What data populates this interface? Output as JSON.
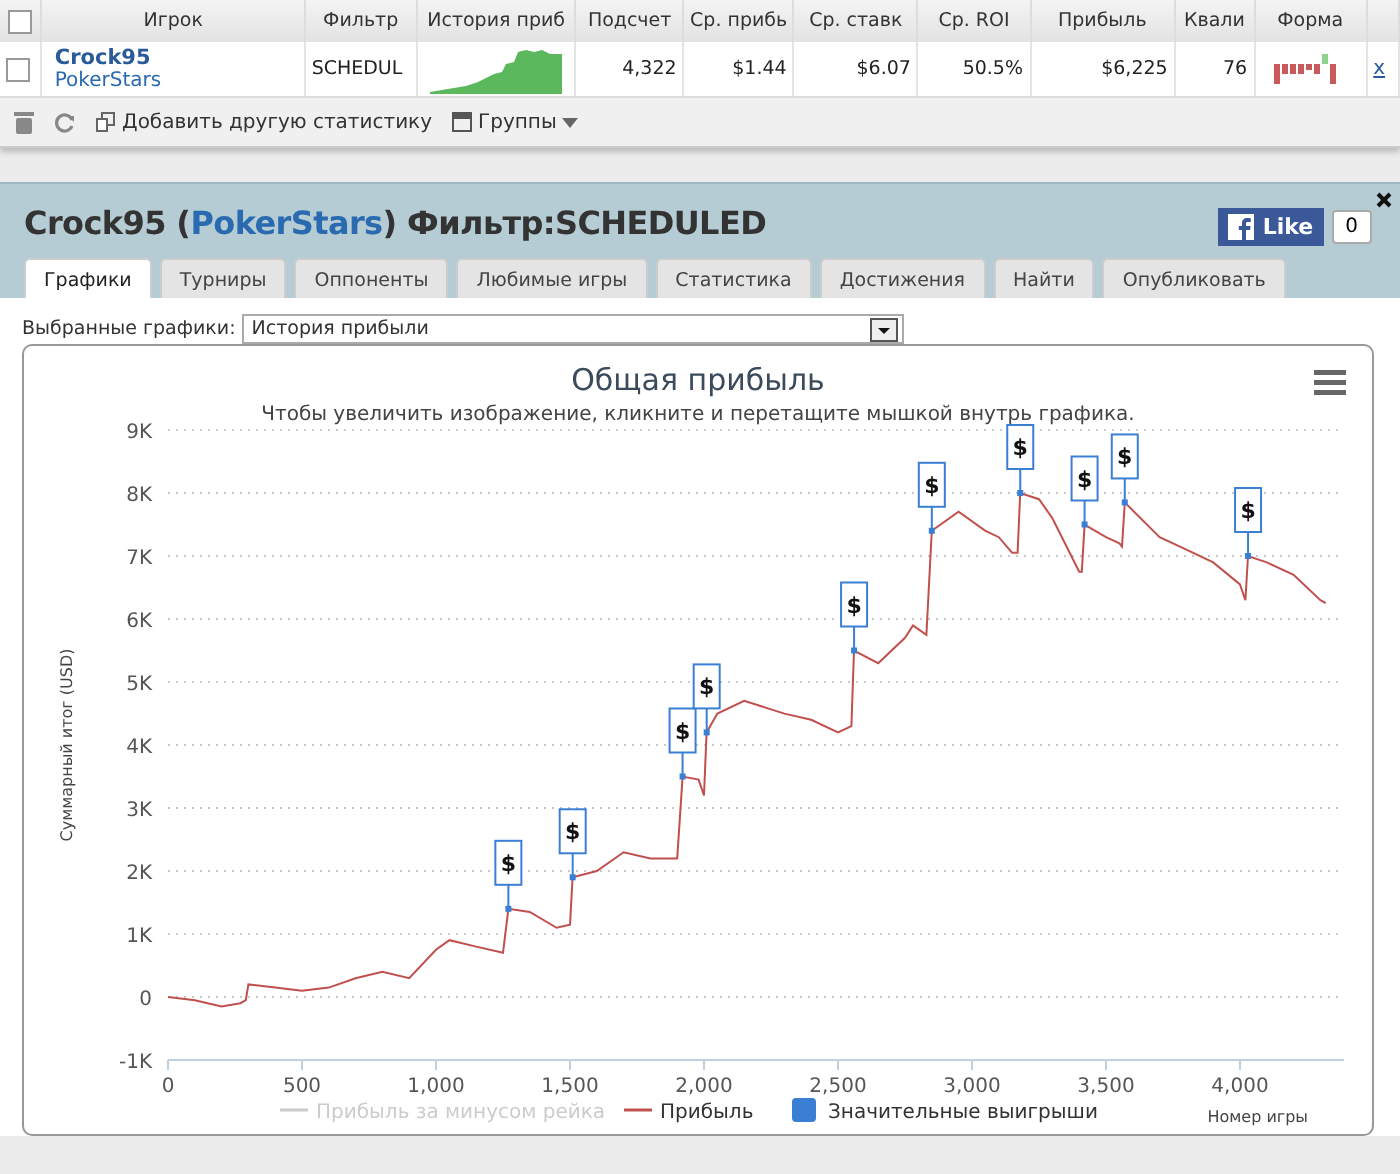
{
  "stats_table": {
    "all_checked": false,
    "columns": [
      "Игрок",
      "Фильтр",
      "История приб",
      "Подсчет",
      "Ср. прибь",
      "Ср. ставк",
      "Ср. ROI",
      "Прибыль",
      "Квали",
      "Форма"
    ],
    "rows": [
      {
        "checked": false,
        "player": "Crock95",
        "site": "PokerStars",
        "filter": "SCHEDUL",
        "count": "4,322",
        "avg_profit": "$1.44",
        "avg_stake": "$6.07",
        "avg_roi": "50.5%",
        "profit": "$6,225",
        "qualif": "76",
        "remove": "x"
      }
    ],
    "toolbar": {
      "add_stat": "Добавить другую статистику",
      "groups": "Группы"
    }
  },
  "profile": {
    "name": "Crock95",
    "open_paren": "(",
    "site": "PokerStars",
    "close_paren": ")",
    "filter": "Фильтр:SCHEDULED",
    "like": "Like",
    "like_count": "0",
    "tabs": [
      {
        "label": "Графики",
        "selected": true
      },
      {
        "label": "Турниры",
        "selected": false
      },
      {
        "label": "Оппоненты",
        "selected": false
      },
      {
        "label": "Любимые игры",
        "selected": false
      },
      {
        "label": "Статистика",
        "selected": false
      },
      {
        "label": "Достижения",
        "selected": false
      },
      {
        "label": "Найти",
        "selected": false
      },
      {
        "label": "Опубликовать",
        "selected": false
      }
    ],
    "chart_select": {
      "label": "Выбранные графики:",
      "value": "История прибыли"
    },
    "chart": {
      "subtitle": "Чтобы увеличить изображение, кликните и перетащите мышкой внутрь графика.",
      "hidden_legend": [
        {
          "label": "Прибыль за минусом рейка",
          "visible": false
        }
      ],
      "flag_labels": [
        "$",
        "$",
        "$",
        "$",
        "$",
        "$",
        "$",
        "$",
        "$",
        "$"
      ],
      "chart_data": {
        "type": "line",
        "title": "Общая прибыль",
        "xlabel": "Номер игры",
        "ylabel": "Суммарный итог (USD)",
        "xlim": [
          0,
          4388
        ],
        "ylim": [
          -1000,
          9000
        ],
        "grid": true,
        "legend": true,
        "xticks": [
          {
            "value": 0,
            "label": "0"
          },
          {
            "value": 500,
            "label": "500"
          },
          {
            "value": 1000,
            "label": "1,000"
          },
          {
            "value": 1500,
            "label": "1,500"
          },
          {
            "value": 2000,
            "label": "2,000"
          },
          {
            "value": 2500,
            "label": "2,500"
          },
          {
            "value": 3000,
            "label": "3,000"
          },
          {
            "value": 3500,
            "label": "3,500"
          },
          {
            "value": 4000,
            "label": "4,000"
          }
        ],
        "yticks": [
          {
            "value": -1000,
            "label": "-1K"
          },
          {
            "value": 0,
            "label": "0"
          },
          {
            "value": 1000,
            "label": "1K"
          },
          {
            "value": 2000,
            "label": "2K"
          },
          {
            "value": 3000,
            "label": "3K"
          },
          {
            "value": 4000,
            "label": "4K"
          },
          {
            "value": 5000,
            "label": "5K"
          },
          {
            "value": 6000,
            "label": "6K"
          },
          {
            "value": 7000,
            "label": "7K"
          },
          {
            "value": 8000,
            "label": "8K"
          },
          {
            "value": 9000,
            "label": "9K"
          }
        ],
        "x": [
          0,
          100,
          200,
          270,
          290,
          300,
          400,
          500,
          600,
          700,
          800,
          900,
          1000,
          1050,
          1150,
          1250,
          1270,
          1350,
          1450,
          1500,
          1510,
          1600,
          1700,
          1800,
          1900,
          1920,
          1980,
          2000,
          2010,
          2050,
          2150,
          2300,
          2400,
          2500,
          2550,
          2560,
          2650,
          2750,
          2780,
          2830,
          2850,
          2950,
          3050,
          3100,
          3150,
          3170,
          3180,
          3250,
          3300,
          3400,
          3410,
          3420,
          3500,
          3550,
          3560,
          3570,
          3700,
          3800,
          3900,
          4000,
          4020,
          4030,
          4100,
          4200,
          4300,
          4320
        ],
        "series": [
          {
            "name": "Прибыль",
            "color": "#c0504d",
            "values": [
              0,
              -50,
              -150,
              -100,
              -50,
              200,
              150,
              100,
              150,
              300,
              400,
              300,
              750,
              900,
              800,
              700,
              1400,
              1350,
              1100,
              1150,
              1900,
              2000,
              2300,
              2200,
              2200,
              3500,
              3450,
              3200,
              4200,
              4500,
              4700,
              4500,
              4400,
              4200,
              4300,
              5500,
              5300,
              5700,
              5900,
              5750,
              7400,
              7700,
              7400,
              7300,
              7050,
              7050,
              8000,
              7900,
              7600,
              6750,
              6750,
              7500,
              7300,
              7200,
              7150,
              7850,
              7300,
              7100,
              6900,
              6550,
              6300,
              7000,
              6900,
              6700,
              6300,
              6250
            ]
          },
          {
            "name": "Значительные выигрыши",
            "color": "#3b7fd4",
            "marker": "square",
            "values": [
              null,
              null,
              null,
              null,
              null,
              null,
              null,
              null,
              null,
              null,
              null,
              null,
              null,
              null,
              null,
              null,
              1400,
              null,
              null,
              null,
              1900,
              null,
              null,
              null,
              null,
              3500,
              null,
              null,
              4200,
              null,
              null,
              null,
              null,
              null,
              null,
              5500,
              null,
              null,
              null,
              null,
              7400,
              null,
              null,
              null,
              null,
              null,
              8000,
              null,
              null,
              null,
              null,
              7500,
              null,
              null,
              null,
              7850,
              null,
              null,
              null,
              null,
              null,
              7000,
              null,
              null,
              null,
              null
            ]
          }
        ]
      }
    }
  }
}
